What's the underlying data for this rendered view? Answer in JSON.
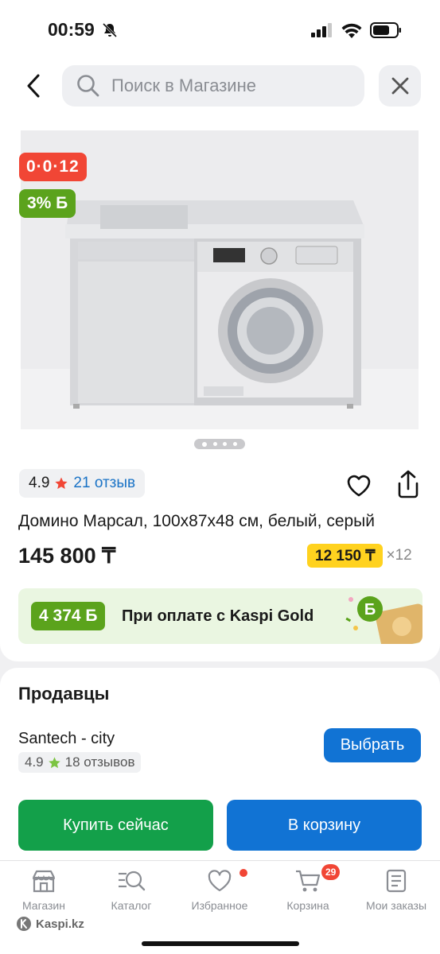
{
  "status": {
    "time": "00:59"
  },
  "search": {
    "placeholder": "Поиск в Магазине"
  },
  "product": {
    "timer_badge": "0·0·12",
    "bonus_badge": "3% Б",
    "rating": "4.9",
    "reviews": "21 отзыв",
    "title": "Домино Марсал, 100x87x48 см, белый, серый",
    "price": "145 800 ₸",
    "installment_amount": "12 150 ₸",
    "installment_months": "×12",
    "gallery_current": 1,
    "gallery_total": 4
  },
  "gold_banner": {
    "amount": "4 374 Б",
    "text": "При оплате с Kaspi Gold"
  },
  "sellers": {
    "heading": "Продавцы",
    "seller_name": "Santech - city",
    "seller_rating": "4.9",
    "seller_reviews": "18 отзывов",
    "choose_label": "Выбрать"
  },
  "actions": {
    "buy_now": "Купить сейчас",
    "to_cart": "В корзину"
  },
  "tabs": [
    {
      "label": "Магазин",
      "icon": "shop-icon"
    },
    {
      "label": "Каталог",
      "icon": "catalog-icon"
    },
    {
      "label": "Избранное",
      "icon": "heart-icon"
    },
    {
      "label": "Корзина",
      "icon": "cart-icon",
      "badge": "29"
    },
    {
      "label": "Мои заказы",
      "icon": "orders-icon"
    }
  ],
  "footer": {
    "logo_text": "Kaspi.kz"
  },
  "colors": {
    "kaspi_blue": "#1173d4",
    "green": "#13a04a",
    "red": "#f14635",
    "bonus_green": "#5ba31c",
    "yellow": "#ffd21f"
  }
}
